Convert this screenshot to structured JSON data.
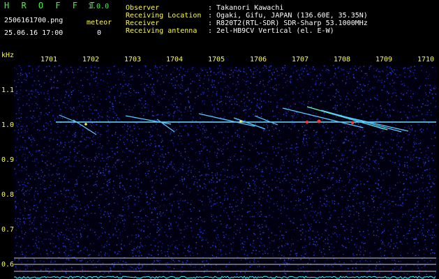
{
  "header": {
    "app_name": "H R O F F T",
    "version": "1.0.0",
    "filename": "2506161700.png",
    "datetime": "25.06.16 17:00",
    "meteor_label": "meteor",
    "meteor_count": "0",
    "info": [
      {
        "label": "Observer",
        "value": ": Takanori Kawachi"
      },
      {
        "label": "Receiving Location",
        "value": ": Ogaki, Gifu, JAPAN (136.60E, 35.35N)"
      },
      {
        "label": "Receiver",
        "value": ": R820T2(RTL-SDR) SDR-Sharp 53.1000MHz"
      },
      {
        "label": "Receiving antenna",
        "value": ": 2el-HB9CV Vertical (el. E-W)"
      }
    ]
  },
  "axis": {
    "unit": "kHz",
    "x_ticks": [
      "1701",
      "1702",
      "1703",
      "1704",
      "1705",
      "1706",
      "1707",
      "1708",
      "1709",
      "1710"
    ],
    "y_ticks": [
      "1.1",
      "1.0",
      "0.9",
      "0.8",
      "0.7",
      "0.6"
    ]
  },
  "colors": {
    "background": "#000000",
    "noise": "#1a22aa",
    "carrier": "#66ddff",
    "meteor_hot": "#ff3333",
    "header_green": "#33ff33",
    "header_yellow": "#ffff33"
  }
}
